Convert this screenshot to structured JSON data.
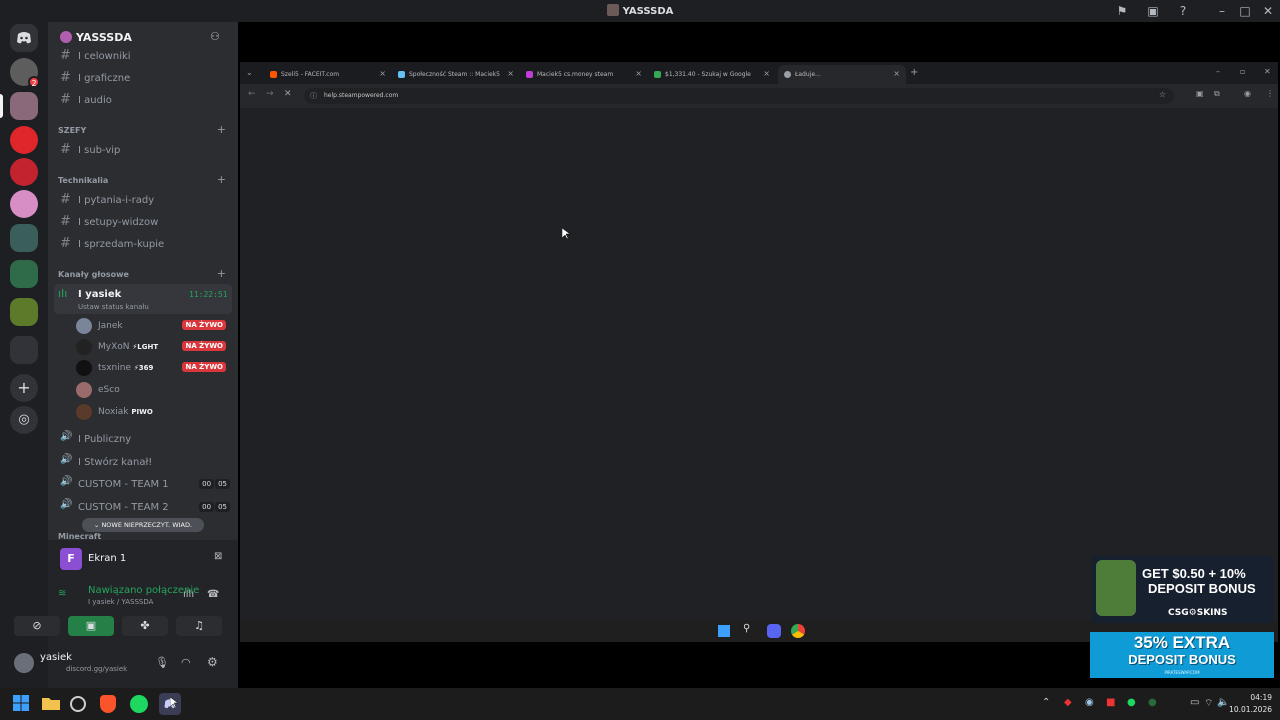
{
  "window": {
    "title": "YASSSDA"
  },
  "server": {
    "name": "YASSSDA"
  },
  "channels_top": [
    {
      "label": "I celowniki"
    },
    {
      "label": "I graficzne"
    },
    {
      "label": "I audio"
    }
  ],
  "categories": {
    "szefy": "SZEFY",
    "techniczne": "Technikalia",
    "voice": "Kanały głosowe",
    "minecraft": "Minecraft"
  },
  "channels_szefy": [
    {
      "label": "I sub-vip"
    }
  ],
  "channels_tech": [
    {
      "label": "I pytania-i-rady"
    },
    {
      "label": "I setupy-widzow"
    },
    {
      "label": "I sprzedam-kupie"
    }
  ],
  "voice_active": {
    "label": "I yasiek",
    "time": "11:22:51",
    "status": "Ustaw status kanału"
  },
  "voice_users": [
    {
      "name": "Janek",
      "tag": "",
      "live": "NA ŻYWO"
    },
    {
      "name": "MyXoN",
      "tag": "⚡LGHT",
      "live": "NA ŻYWO"
    },
    {
      "name": "tsxnine",
      "tag": "⚡369",
      "live": "NA ŻYWO"
    },
    {
      "name": "eSco",
      "tag": "",
      "live": ""
    },
    {
      "name": "Noxiak",
      "tag": "PIWO",
      "live": ""
    }
  ],
  "voice_channels": [
    {
      "label": "I Publiczny",
      "c1": "",
      "c2": ""
    },
    {
      "label": "I Stwórz kanał!",
      "c1": "",
      "c2": ""
    },
    {
      "label": "CUSTOM - TEAM 1",
      "c1": "00",
      "c2": "05"
    },
    {
      "label": "CUSTOM - TEAM 2",
      "c1": "00",
      "c2": "05"
    }
  ],
  "new_messages_pill": "NOWE NIEPRZECZYT. WIAD.",
  "stream": {
    "label": "Ekran 1",
    "avatar_letter": "F"
  },
  "connection": {
    "status": "Nawiązano połączenie",
    "location": "I yasiek / YASSSDA"
  },
  "user": {
    "name": "yasiek",
    "sub": "discord.gg/yasiek"
  },
  "browser": {
    "tabs": [
      {
        "label": "Szeli5 - FACEIT.com",
        "color": "#ff5500"
      },
      {
        "label": "Społeczność Steam :: Maciek5",
        "color": "#66c0f4"
      },
      {
        "label": "Maciek5 cs.money steam",
        "color": "#c13bd6"
      },
      {
        "label": "$1,331.40 - Szukaj w Google",
        "color": "#34a853"
      },
      {
        "label": "Ładuje...",
        "color": "#9aa0a6"
      }
    ],
    "url": "help.steampowered.com"
  },
  "ads": {
    "csg": {
      "line1": "GET $0.50 + 10%",
      "line2": "DEPOSIT BONUS",
      "brand": "CSG⚙SKINS"
    },
    "pirate": {
      "line1": "35% EXTRA",
      "line2": "DEPOSIT BONUS",
      "brand": "PIRATESWAP.COM"
    }
  },
  "taskbar": {
    "time": "04:19",
    "date": "10.01.2026"
  }
}
